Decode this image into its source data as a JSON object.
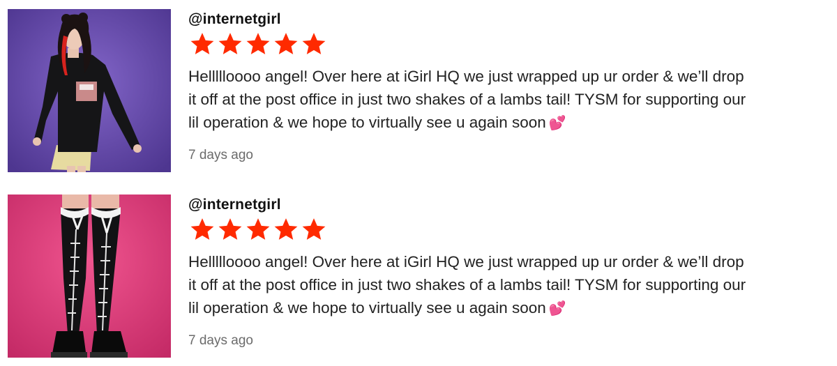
{
  "reviews": [
    {
      "username": "@internetgirl",
      "rating": 5,
      "message_lines": [
        "Hellllloooo angel! Over here at iGirl HQ we just wrapped up ur order & we’ll drop",
        "it off at the post office in just two shakes of a lambs tail! TYSM for supporting our",
        "lil operation & we hope to virtually see u again soon"
      ],
      "emoji": "💕",
      "time_ago": "7 days ago",
      "photo": "model-black-sweatshirt-purple-background"
    },
    {
      "username": "@internetgirl",
      "rating": 5,
      "message_lines": [
        "Hellllloooo angel! Over here at iGirl HQ we just wrapped up ur order & we’ll drop",
        "it off at the post office in just two shakes of a lambs tail! TYSM for supporting our",
        "lil operation & we hope to virtually see u again soon"
      ],
      "emoji": "💕",
      "time_ago": "7 days ago",
      "photo": "black-stitched-thigh-high-socks-pink-background"
    }
  ],
  "colors": {
    "star": "#ff2a00",
    "timestamp": "#6b6b6b",
    "purple_bg": "#6b4fb0",
    "pink_bg": "#e8407f"
  }
}
